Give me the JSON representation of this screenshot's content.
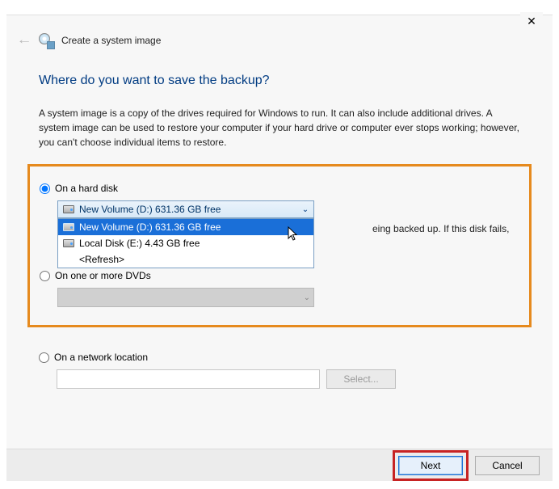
{
  "titlebar": {
    "close": "✕"
  },
  "header": {
    "back": "←",
    "title": "Create a system image"
  },
  "heading": "Where do you want to save the backup?",
  "description": "A system image is a copy of the drives required for Windows to run. It can also include additional drives. A system image can be used to restore your computer if your hard drive or computer ever stops working; however, you can't choose individual items to restore.",
  "options": {
    "hard_disk": {
      "label": "On a hard disk",
      "selected_text": "New Volume (D:)  631.36 GB free",
      "items": [
        {
          "label": "New Volume (D:)  631.36 GB free",
          "selected": true
        },
        {
          "label": "Local Disk (E:)  4.43 GB free",
          "selected": false
        },
        {
          "label": "<Refresh>",
          "selected": false
        }
      ],
      "side_text": "eing backed up. If this disk fails,"
    },
    "dvd": {
      "label": "On one or more DVDs"
    },
    "network": {
      "label": "On a network location",
      "select_btn": "Select..."
    }
  },
  "footer": {
    "next": "Next",
    "cancel": "Cancel"
  }
}
